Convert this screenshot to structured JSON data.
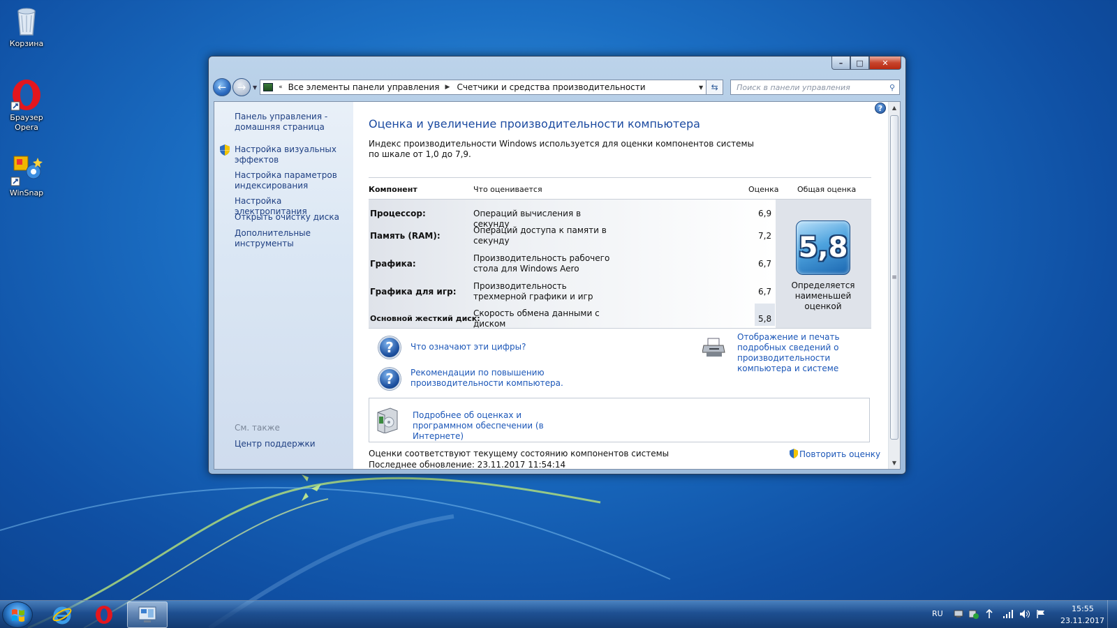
{
  "desktop": {
    "icons": [
      {
        "label": "Корзина",
        "icon": "recycle-bin-icon"
      },
      {
        "label": "Браузер Opera",
        "icon": "opera-icon"
      },
      {
        "label": "WinSnap",
        "icon": "winsnap-icon"
      }
    ]
  },
  "window": {
    "controls": {
      "minimize": "–",
      "maximize": "□",
      "close": "✕"
    },
    "breadcrumb": [
      "Все элементы панели управления",
      "Счетчики и средства производительности"
    ],
    "search_placeholder": "Поиск в панели управления",
    "sidebar": {
      "links": [
        "Панель управления - домашняя страница",
        "Настройка визуальных эффектов",
        "Настройка параметров индексирования",
        "Настройка электропитания",
        "Открыть очистку диска",
        "Дополнительные инструменты"
      ],
      "see_also_title": "См. также",
      "see_also": [
        "Центр поддержки"
      ]
    },
    "main": {
      "title": "Оценка и увеличение производительности компьютера",
      "subtitle": "Индекс производительности Windows используется для оценки компонентов системы по шкале от 1,0 до 7,9.",
      "table": {
        "headers": [
          "Компонент",
          "Что оценивается",
          "Оценка",
          "Общая оценка"
        ],
        "rows": [
          {
            "component": "Процессор:",
            "rated": "Операций вычисления в секунду",
            "score": "6,9"
          },
          {
            "component": "Память (RAM):",
            "rated": "Операций доступа к памяти в секунду",
            "score": "7,2"
          },
          {
            "component": "Графика:",
            "rated": "Производительность рабочего стола для Windows Aero",
            "score": "6,7"
          },
          {
            "component": "Графика для игр:",
            "rated": "Производительность трехмерной графики и игр",
            "score": "6,7"
          },
          {
            "component": "Основной жесткий диск:",
            "rated": "Скорость обмена данными с диском",
            "score": "5,8"
          }
        ],
        "base_score": "5,8",
        "base_caption": "Определяется наименьшей оценкой"
      },
      "links": {
        "what_numbers": "Что означают эти цифры?",
        "tips": "Рекомендации по повышению производительности компьютера.",
        "print_details": "Отображение и печать подробных сведений о производительности компьютера и системе",
        "online_info": "Подробнее об оценках и программном обеспечении (в Интернете)",
        "rerun": "Повторить оценку"
      },
      "status": "Оценки соответствуют текущему состоянию компонентов системы",
      "status_cut": "Последнее обновление: 23.11.2017 11:54:14"
    }
  },
  "taskbar": {
    "language": "RU",
    "time": "15:55",
    "date": "23.11.2017"
  }
}
